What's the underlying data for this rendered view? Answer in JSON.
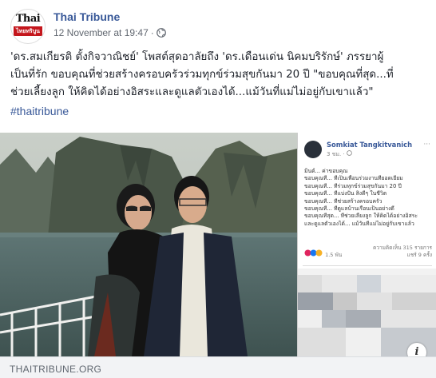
{
  "post": {
    "page_name": "Thai Tribune",
    "timestamp": "12 November at 19:47",
    "separator": "·",
    "privacy_icon": "globe-icon",
    "avatar": {
      "logo_top": "Thai",
      "logo_bottom": "Tribune",
      "logo_thai": "ไทยทริบูน"
    },
    "message_lines": [
      "'ดร.สมเกียรติ ตั้งกิจวาณิชย์' โพสต์สุดอาลัยถึง 'ดร.เดือนเด่น นิคมบริรักษ์' ภรรยาผู้",
      "เป็นที่รัก ขอบคุณที่ช่วยสร้างครอบครัวร่วมทุกข์ร่วมสุขกันมา 20 ปี \"ขอบคุณที่สุด...ที่",
      "ช่วยเลี้ยงลูก ให้คิดได้อย่างอิสระและดูแลตัวเองได้...แม้วันที่แม่ไม่อยู่กับเขาแล้ว\""
    ],
    "hashtag": "#thaitribune"
  },
  "embedded_post": {
    "author": "Somkiat Tangkitvanich",
    "time": "3 ชม. · ",
    "menu": "···",
    "lines": [
      "มิ้นต์... ค่าขอบคุณ",
      "ขอบคุณที่... ที่เป็นเพื่อนร่วมงานที่ยอดเยี่ยม",
      "ขอบคุณที่... ที่ร่วมทุกข์ร่วมสุขกันมา 20 ปี",
      "ขอบคุณที่... ที่แบ่งปัน สิ่งดีๆ ในชีวิต",
      "ขอบคุณที่... ที่ช่วยสร้างครอบครัว",
      "ขอบคุณที่... ที่ดูแลบ้านเรือนเป็นอย่างดี",
      "ขอบคุณที่สุด... ที่ช่วยเลี้ยงลูก ให้คิดได้อย่างอิสระ",
      "และดูแลตัวเองได้... แม้วันที่แม่ไม่อยู่กับเขาแล้ว"
    ],
    "reactions": "1.5 พัน",
    "counts": [
      "ความคิดเห็น 315 รายการ",
      "แชร์ 9 ครั้ง"
    ]
  },
  "link_preview": {
    "domain": "THAITRIBUNE.ORG",
    "info_label": "i"
  },
  "colors": {
    "link_blue": "#385898",
    "text": "#1d2129",
    "meta_gray": "#616770",
    "logo_red": "#c4161c"
  }
}
